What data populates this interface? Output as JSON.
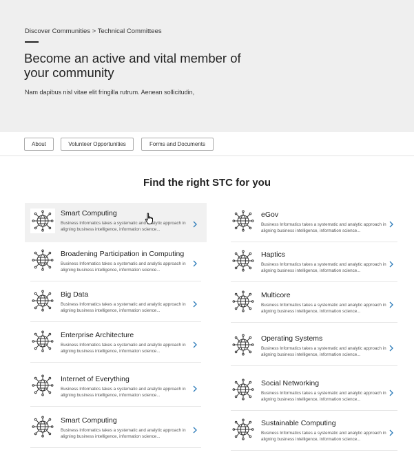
{
  "breadcrumb": {
    "parent": "Discover Communities",
    "separator": " > ",
    "current": "Technical Committees"
  },
  "hero": {
    "title": "Become an active and vital member of your community",
    "subtitle": "Nam dapibus nisl vitae elit fringilla rutrum. Aenean sollicitudin,"
  },
  "tabs": [
    {
      "label": "About"
    },
    {
      "label": "Volunteer Opportunities"
    },
    {
      "label": "Forms and Documents"
    }
  ],
  "section": {
    "title": "Find the right STC for you"
  },
  "icons": {
    "committee": "globe-network-icon",
    "arrow": "chevron-right-icon"
  },
  "colors": {
    "hero_bg": "#efefef",
    "chevron": "#2a7ab8",
    "active_row_bg": "#f1f1f1"
  },
  "committees_left": [
    {
      "name": "Smart Computing",
      "desc": "Business Informatics takes a systematic and analytic approach in aligning business intelligence, information science...",
      "active": true
    },
    {
      "name": "Broadening Participation in Computing",
      "desc": "Business Informatics takes a systematic and analytic approach in aligning business intelligence, information science..."
    },
    {
      "name": "Big Data",
      "desc": "Business Informatics takes a systematic and analytic approach in aligning business intelligence, information science..."
    },
    {
      "name": "Enterprise Architecture",
      "desc": "Business Informatics takes a systematic and analytic approach in aligning business intelligence, information science..."
    },
    {
      "name": "Internet of Everything",
      "desc": "Business Informatics takes a systematic and analytic approach in aligning business intelligence, information science..."
    },
    {
      "name": "Smart Computing",
      "desc": "Business Informatics takes a systematic and analytic approach in aligning business intelligence, information science..."
    }
  ],
  "committees_right": [
    {
      "name": "eGov",
      "desc": "Business Informatics takes a systematic and analytic approach in aligning business intelligence, information science..."
    },
    {
      "name": "Haptics",
      "desc": "Business Informatics takes a systematic and analytic approach in aligning business intelligence, information science..."
    },
    {
      "name": "Multicore",
      "desc": "Business Informatics takes a systematic and analytic approach in aligning business intelligence, information science..."
    },
    {
      "name": "Operating Systems",
      "desc": "Business Informatics takes a systematic and analytic approach in aligning business intelligence, information science..."
    },
    {
      "name": "Social Networking",
      "desc": "Business Informatics takes a systematic and analytic approach in aligning business intelligence, information science..."
    },
    {
      "name": "Sustainable Computing",
      "desc": "Business Informatics takes a systematic and analytic approach in aligning business intelligence, information science..."
    }
  ]
}
